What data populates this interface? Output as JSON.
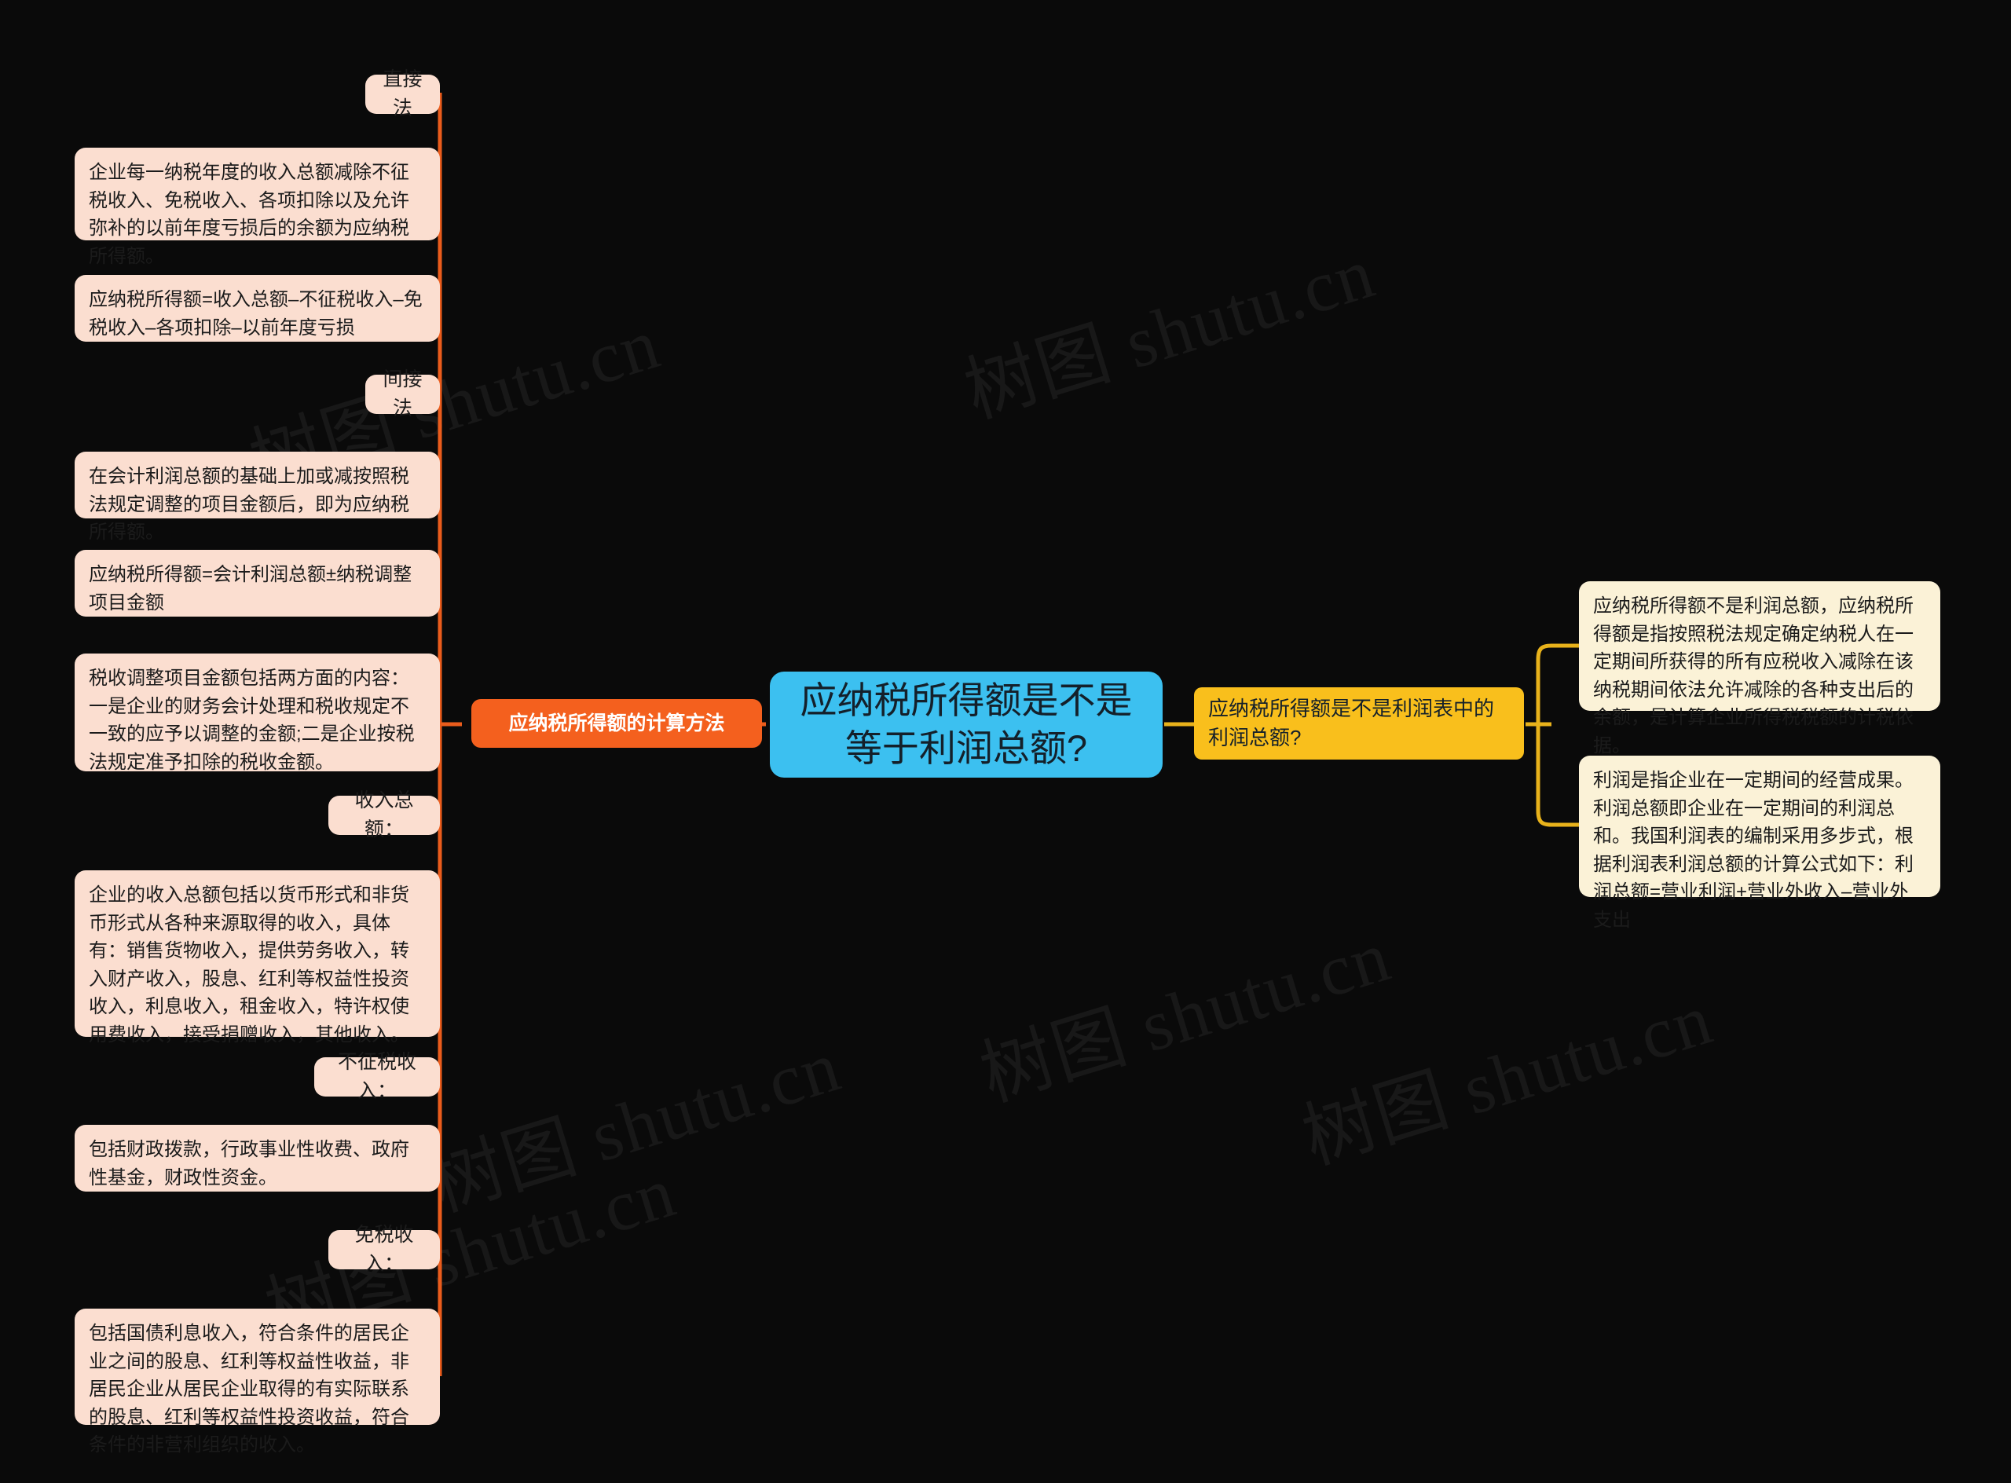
{
  "background_color": "#0a0a0a",
  "colors": {
    "center_node": "#3cc0f0",
    "left_branch": "#f4601e",
    "right_branch": "#f9bf1c",
    "left_leaf": "#fbded0",
    "right_leaf": "#fbf2d7",
    "left_wire": "#ea5c1c",
    "right_wire": "#e8b21b"
  },
  "watermark": {
    "text": "树图 shutu.cn"
  },
  "center": {
    "label": "应纳税所得额是不是等于利润总额?"
  },
  "left_branch": {
    "label": "应纳税所得额的计算方法",
    "children": [
      {
        "label": "直接法",
        "type": "topic"
      },
      {
        "label": "企业每一纳税年度的收入总额减除不征税收入、免税收入、各项扣除以及允许弥补的以前年度亏损后的余额为应纳税所得额。",
        "type": "detail"
      },
      {
        "label": "应纳税所得额=收入总额–不征税收入–免税收入–各项扣除–以前年度亏损",
        "type": "detail"
      },
      {
        "label": "间接法",
        "type": "topic"
      },
      {
        "label": "在会计利润总额的基础上加或减按照税法规定调整的项目金额后，即为应纳税所得额。",
        "type": "detail"
      },
      {
        "label": "应纳税所得额=会计利润总额±纳税调整项目金额",
        "type": "detail"
      },
      {
        "label": "税收调整项目金额包括两方面的内容：一是企业的财务会计处理和税收规定不一致的应予以调整的金额;二是企业按税法规定准予扣除的税收金额。",
        "type": "detail"
      },
      {
        "label": "收入总额：",
        "type": "topic"
      },
      {
        "label": "企业的收入总额包括以货币形式和非货币形式从各种来源取得的收入，具体有：销售货物收入，提供劳务收入，转入财产收入，股息、红利等权益性投资收入，利息收入，租金收入，特许权使用费收入，接受捐赠收入，其他收入。",
        "type": "detail"
      },
      {
        "label": "不征税收入：",
        "type": "topic"
      },
      {
        "label": "包括财政拨款，行政事业性收费、政府性基金，财政性资金。",
        "type": "detail"
      },
      {
        "label": "免税收入：",
        "type": "topic"
      },
      {
        "label": "包括国债利息收入，符合条件的居民企业之间的股息、红利等权益性收益，非居民企业从居民企业取得的有实际联系的股息、红利等权益性投资收益，符合条件的非营利组织的收入。",
        "type": "detail"
      }
    ]
  },
  "right_branch": {
    "label": "应纳税所得额是不是利润表中的利润总额?",
    "children": [
      {
        "label": "应纳税所得额不是利润总额，应纳税所得额是指按照税法规定确定纳税人在一定期间所获得的所有应税收入减除在该纳税期间依法允许减除的各种支出后的余额，是计算企业所得税税额的计税依据。"
      },
      {
        "label": "利润是指企业在一定期间的经营成果。利润总额即企业在一定期间的利润总和。我国利润表的编制采用多步式，根据利润表利润总额的计算公式如下：利润总额=营业利润+营业外收入–营业外支出"
      }
    ]
  }
}
